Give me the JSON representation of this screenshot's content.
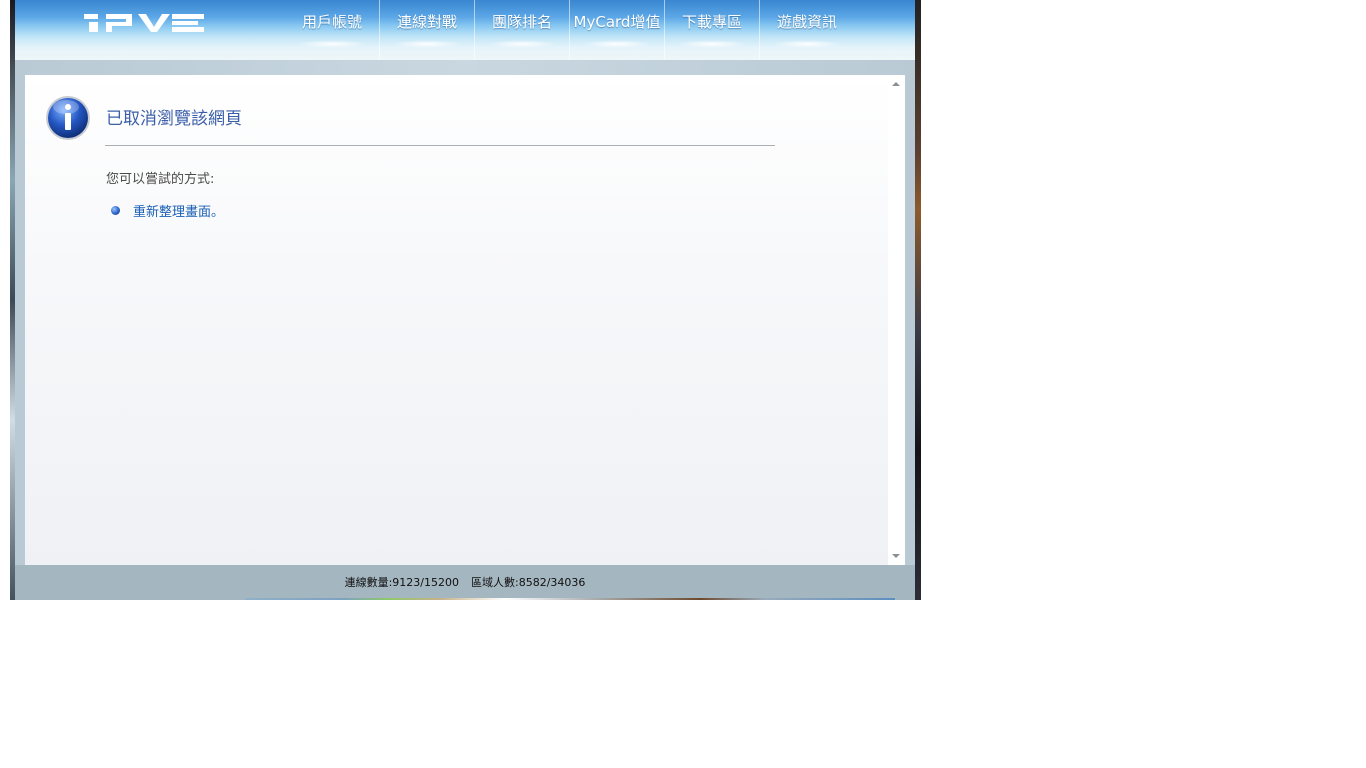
{
  "header": {
    "logo_text": "IPVE",
    "nav": [
      {
        "label": "用戶帳號"
      },
      {
        "label": "連線對戰"
      },
      {
        "label": "團隊排名"
      },
      {
        "label": "MyCard增值"
      },
      {
        "label": "下載專區"
      },
      {
        "label": "遊戲資訊"
      }
    ]
  },
  "error_page": {
    "icon": "info-icon",
    "title": "已取消瀏覽該網頁",
    "suggest_label": "您可以嘗試的方式:",
    "suggestions": [
      {
        "label": "重新整理畫面。"
      }
    ]
  },
  "footer": {
    "connections_label": "連線數量:",
    "connections_value": "9123/15200",
    "region_label": "區域人數:",
    "region_value": "8582/34036"
  },
  "colors": {
    "header_blue": "#3a86d0",
    "title_blue": "#3b5ea8",
    "link_blue": "#1a5fb4",
    "footer_bg": "#a4b6bf"
  }
}
